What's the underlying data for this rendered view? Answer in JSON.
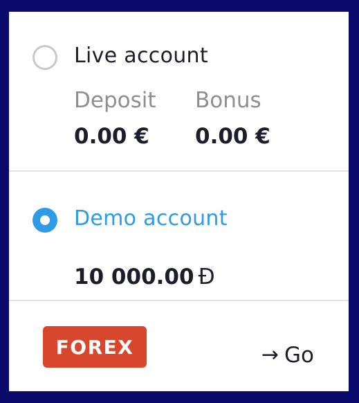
{
  "live_account": {
    "title": "Live account",
    "selected": false,
    "deposit_label": "Deposit",
    "deposit_value": "0.00 €",
    "bonus_label": "Bonus",
    "bonus_value": "0.00 €"
  },
  "demo_account": {
    "title": "Demo account",
    "selected": true,
    "balance": "10 000.00",
    "currency_symbol": "Ð"
  },
  "footer": {
    "brand": "FOREX",
    "go_label": "Go",
    "go_icon": "arrow-right-icon"
  },
  "colors": {
    "accent": "#2f9ae6",
    "brand_bg": "#d9462e",
    "frame": "#0a0a6b"
  }
}
